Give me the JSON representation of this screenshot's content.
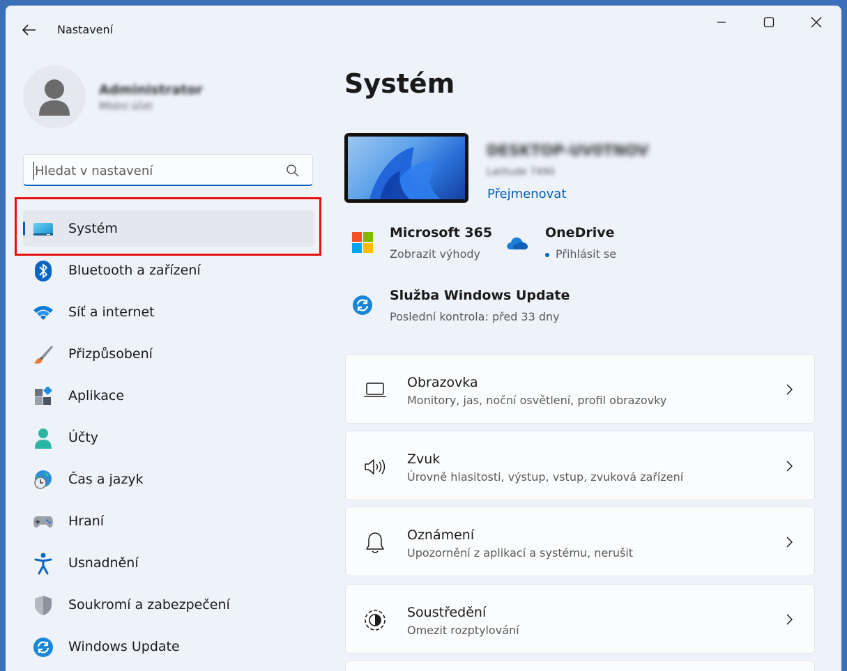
{
  "window": {
    "title": "Nastavení"
  },
  "profile": {
    "name": "Administrator",
    "account_type": "Místní účet"
  },
  "search": {
    "placeholder": "Hledat v nastavení",
    "value": ""
  },
  "sidebar": {
    "items": [
      {
        "label": "Systém",
        "icon": "system-display-icon",
        "selected": true
      },
      {
        "label": "Bluetooth a zařízení",
        "icon": "bluetooth-icon"
      },
      {
        "label": "Síť a internet",
        "icon": "wifi-icon"
      },
      {
        "label": "Přizpůsobení",
        "icon": "brush-icon"
      },
      {
        "label": "Aplikace",
        "icon": "apps-icon"
      },
      {
        "label": "Účty",
        "icon": "account-icon"
      },
      {
        "label": "Čas a jazyk",
        "icon": "globe-clock-icon"
      },
      {
        "label": "Hraní",
        "icon": "gamepad-icon"
      },
      {
        "label": "Usnadnění",
        "icon": "accessibility-icon"
      },
      {
        "label": "Soukromí a zabezpečení",
        "icon": "shield-icon"
      },
      {
        "label": "Windows Update",
        "icon": "update-icon"
      }
    ]
  },
  "main": {
    "title": "Systém",
    "device": {
      "name": "DESKTOP-UV0TNOV",
      "model": "Latitude 7490",
      "rename": "Přejmenovat"
    },
    "tiles": [
      {
        "title": "Microsoft 365",
        "subtitle": "Zobrazit výhody",
        "icon": "microsoft-logo-icon"
      },
      {
        "title": "OneDrive",
        "subtitle": "Přihlásit se",
        "icon": "onedrive-cloud-icon"
      },
      {
        "title": "Služba Windows Update",
        "subtitle": "Poslední kontrola: před 33 dny",
        "icon": "update-icon"
      }
    ],
    "cards": [
      {
        "title": "Obrazovka",
        "subtitle": "Monitory, jas, noční osvětlení, profil obrazovky",
        "icon": "laptop-icon"
      },
      {
        "title": "Zvuk",
        "subtitle": "Úrovně hlasitosti, výstup, vstup, zvuková zařízení",
        "icon": "speaker-icon"
      },
      {
        "title": "Oznámení",
        "subtitle": "Upozornění z aplikací a systému, nerušit",
        "icon": "bell-icon"
      },
      {
        "title": "Soustředění",
        "subtitle": "Omezit rozptylování",
        "icon": "focus-icon"
      }
    ]
  },
  "colors": {
    "accent": "#005fb8",
    "highlight": "#e81010",
    "background": "#eef2f9"
  }
}
